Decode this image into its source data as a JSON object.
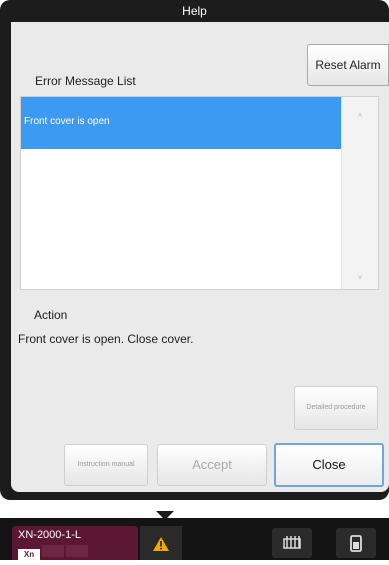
{
  "dialog": {
    "title": "Help",
    "reset_alarm_label": "Reset Alarm",
    "error_list_label": "Error Message List",
    "errors": [
      "Front cover is open"
    ],
    "action_label": "Action",
    "action_text": "Front cover is open. Close cover.",
    "detailed_procedure_label": "Detailed procedure",
    "instruction_manual_label": "Instruction manual",
    "accept_label": "Accept",
    "close_label": "Close"
  },
  "taskbar": {
    "device_name": "XN-2000-1-L",
    "modes": [
      "Xn",
      "",
      ""
    ],
    "warning_icon": "warning-triangle-icon",
    "icons": [
      "analyzer-icon",
      "tube-icon"
    ]
  },
  "colors": {
    "selected_row": "#3d9af2",
    "device_chip": "#5c1734",
    "warning": "#f5a800",
    "close_border": "#6fa7d9"
  }
}
